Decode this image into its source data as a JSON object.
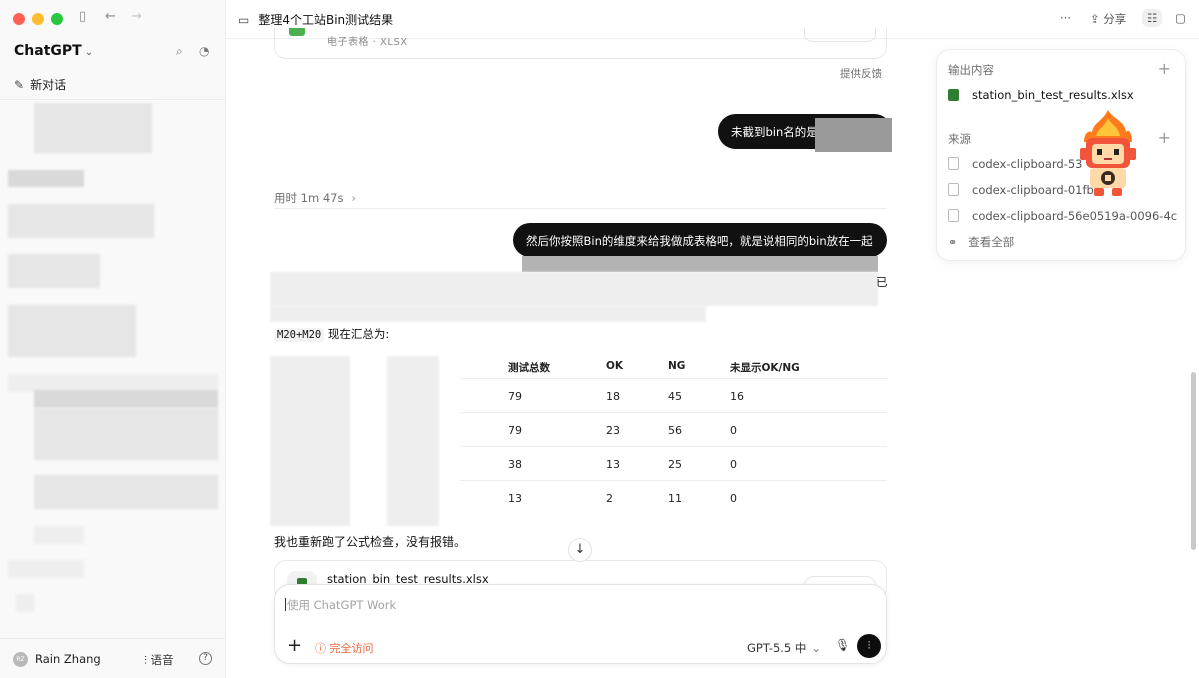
{
  "sidebar": {
    "brand": "ChatGPT",
    "new_chat": "新对话",
    "user_initials": "RZ",
    "user_name": "Rain Zhang",
    "voice_label": "语音",
    "help": "?"
  },
  "header": {
    "title": "整理4个工站Bin测试结果",
    "share_label": "分享"
  },
  "chat": {
    "previous_file_sub": "电子表格 · XLSX",
    "feedback": "提供反馈",
    "user_msg_1": "未截到bin名的是",
    "time_label": "用时 1m 47s",
    "user_msg_2": "然后你按照Bin的维度来给我做成表格吧，就是说相同的bin放在一起",
    "edge_char": "已",
    "summary_code": "M20+M20",
    "summary_text": "现在汇总为:",
    "table": {
      "headers": [
        "测试总数",
        "OK",
        "NG",
        "未显示OK/NG"
      ],
      "rows": [
        [
          "79",
          "18",
          "45",
          "16"
        ],
        [
          "79",
          "23",
          "56",
          "0"
        ],
        [
          "38",
          "13",
          "25",
          "0"
        ],
        [
          "13",
          "2",
          "11",
          "0"
        ]
      ]
    },
    "check_text": "我也重新跑了公式检查，没有报错。",
    "file_name": "station_bin_test_results.xlsx"
  },
  "composer": {
    "placeholder": "使用 ChatGPT Work",
    "access_label": "完全访问",
    "model_label": "GPT-5.5 中"
  },
  "panel": {
    "output_title": "输出内容",
    "output_file": "station_bin_test_results.xlsx",
    "sources_title": "来源",
    "sources": [
      "codex-clipboard-53",
      "codex-clipboard-01fb",
      "codex-clipboard-56e0519a-0096-4c"
    ],
    "view_all": "查看全部"
  },
  "colors": {
    "accent_dark": "#0d0d0d",
    "access_orange": "#e8643a",
    "excel_green": "#2e7d32"
  }
}
